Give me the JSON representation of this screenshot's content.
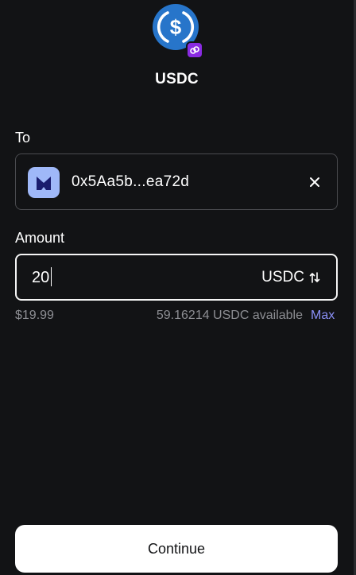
{
  "token": {
    "symbol": "USDC",
    "logo_icon": "usdc-dollar-icon",
    "chain_badge_icon": "chain-link-icon",
    "brand_color": "#2775ca",
    "badge_color": "#8a2be2"
  },
  "form": {
    "to_label": "To",
    "recipient": {
      "address": "0x5Aa5b...ea72d",
      "avatar_icon": "wallet-avatar-icon",
      "clear_icon": "close-icon"
    },
    "amount_label": "Amount",
    "amount": {
      "value": "20",
      "currency": "USDC",
      "toggle_icon": "swap-arrows-icon"
    },
    "fiat_value": "$19.99",
    "available_text": "59.16214 USDC available",
    "max_label": "Max"
  },
  "actions": {
    "continue_label": "Continue"
  },
  "colors": {
    "background": "#121315",
    "accent_link": "#8a8ff5",
    "muted_text": "#8d8e93"
  }
}
